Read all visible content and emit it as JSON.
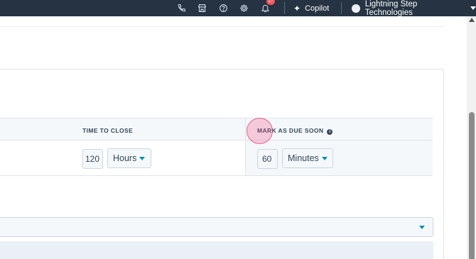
{
  "topbar": {
    "icons": [
      "phone-icon",
      "marketplace-icon",
      "help-icon",
      "settings-icon",
      "notifications-icon"
    ],
    "notification_count": "17",
    "copilot_label": "Copilot",
    "account_name": "Lightning Step Technologies"
  },
  "sla_table": {
    "headers": {
      "time_to_close": "TIME TO CLOSE",
      "mark_as_due_soon": "MARK AS DUE SOON"
    },
    "time_to_close": {
      "value": "120",
      "unit": "Hours"
    },
    "mark_as_due_soon": {
      "value": "60",
      "unit": "Minutes"
    }
  },
  "colors": {
    "topbar": "#253342",
    "accent": "#0091ae",
    "badge": "#f2545b",
    "table_header_bg": "#f5f8fa",
    "click_marker": "#f2548c"
  }
}
